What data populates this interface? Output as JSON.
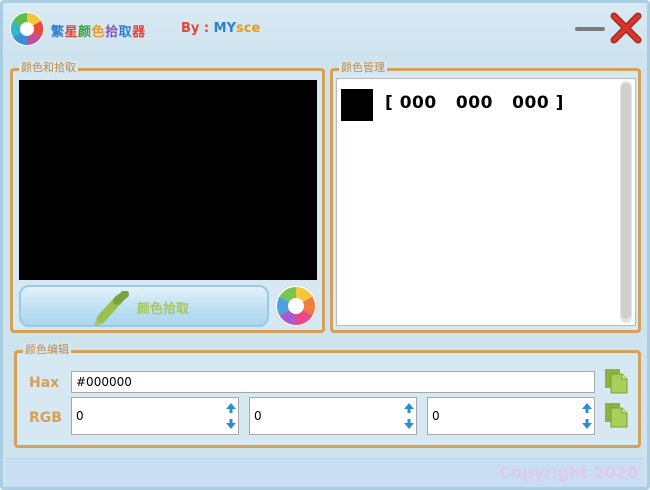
{
  "app": {
    "title": "繁星颜色拾取器",
    "title_colors": [
      "#2e7fd0",
      "#e0453a",
      "#39a33a",
      "#e59a2a",
      "#8a52c7",
      "#2e7fd0",
      "#e0453a"
    ],
    "byline_prefix": "By : ",
    "byline_m": "MY",
    "byline_s": "sce"
  },
  "window_controls": {
    "minimize": "minimize-icon",
    "close": "close-icon"
  },
  "pick_panel": {
    "label": "颜色和拾取",
    "preview_color": "#000000",
    "pick_button_label": "颜色拾取"
  },
  "manage_panel": {
    "label": "颜色管理",
    "items": [
      {
        "swatch": "#000000",
        "text": "[ 000   000   000 ]"
      }
    ]
  },
  "edit_panel": {
    "label": "颜色编辑",
    "hax_label": "Hax",
    "hax_value": "#000000",
    "rgb_label": "RGB",
    "r": "0",
    "g": "0",
    "b": "0"
  },
  "status": {
    "copyright": "Copyright 2020"
  },
  "colors": {
    "accent": "#d4a15a",
    "window_bg": "#cfe3ef",
    "pick_text": "#a9c760"
  }
}
